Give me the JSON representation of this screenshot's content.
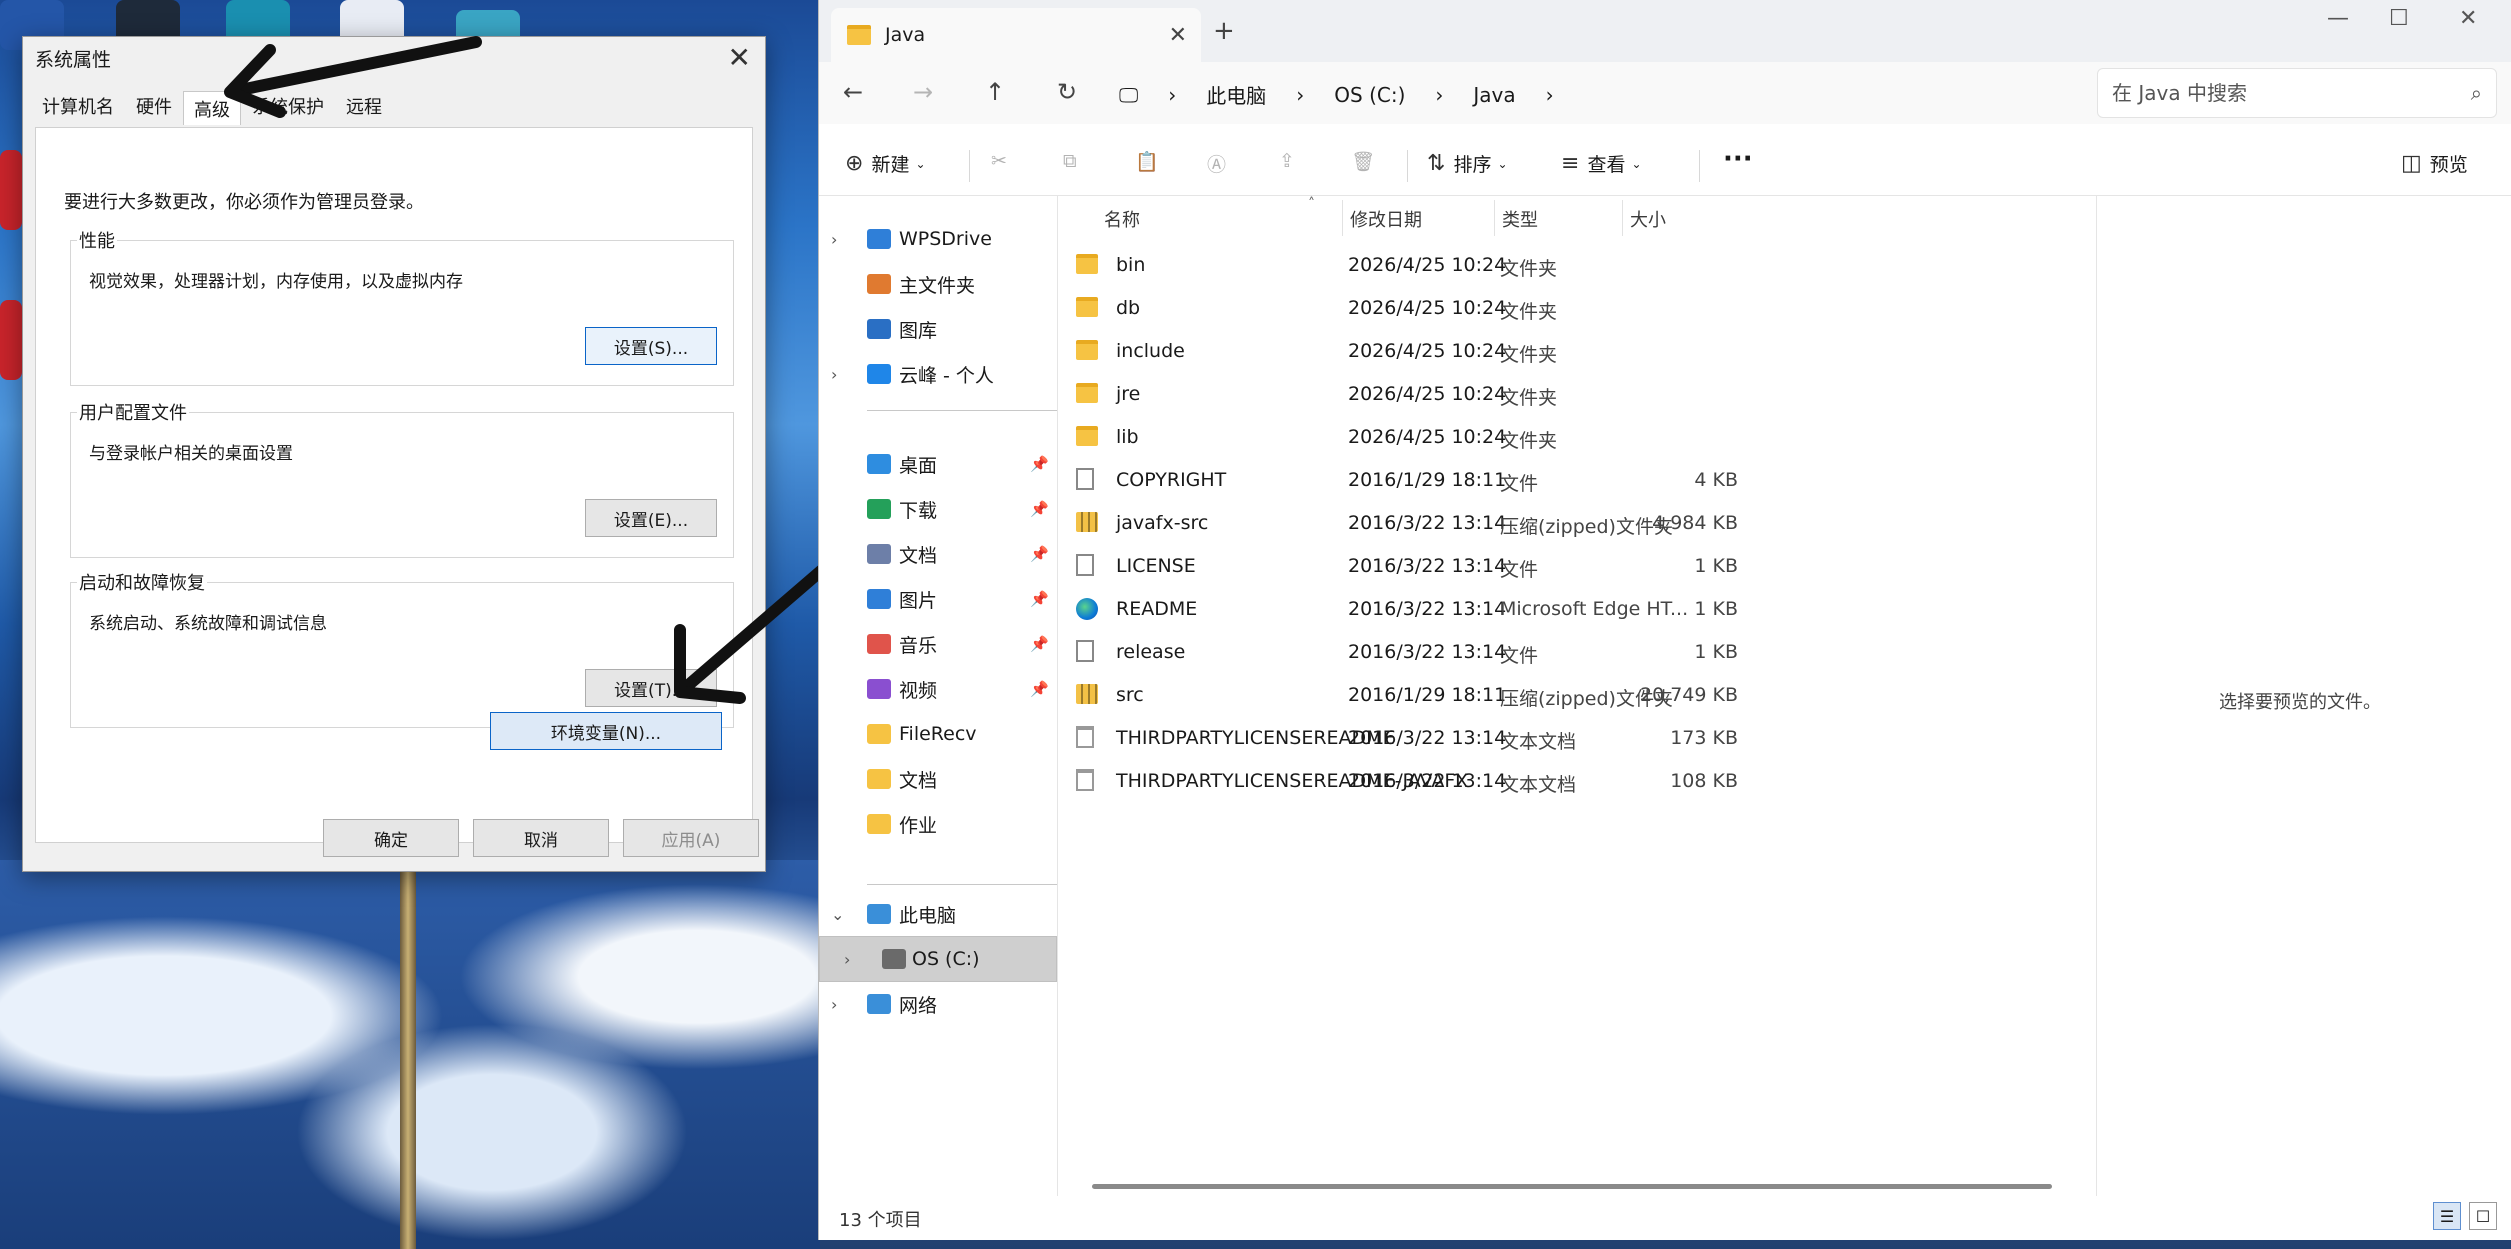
{
  "sysprops": {
    "title": "系统属性",
    "tabs": [
      "计算机名",
      "硬件",
      "高级",
      "系统保护",
      "远程"
    ],
    "admin_note": "要进行大多数更改，你必须作为管理员登录。",
    "performance": {
      "legend": "性能",
      "desc": "视觉效果，处理器计划，内存使用，以及虚拟内存",
      "button": "设置(S)..."
    },
    "profiles": {
      "legend": "用户配置文件",
      "desc": "与登录帐户相关的桌面设置",
      "button": "设置(E)..."
    },
    "startup": {
      "legend": "启动和故障恢复",
      "desc": "系统启动、系统故障和调试信息",
      "button": "设置(T)..."
    },
    "env_button": "环境变量(N)...",
    "ok": "确定",
    "cancel": "取消",
    "apply": "应用(A)"
  },
  "explorer": {
    "tab_title": "Java",
    "breadcrumb": [
      "此电脑",
      "OS (C:)",
      "Java"
    ],
    "search_placeholder": "在 Java 中搜索",
    "cmd": {
      "new": "新建",
      "sort": "排序",
      "view": "查看",
      "more": "···",
      "preview": "预览"
    },
    "sidebar": [
      {
        "label": "WPSDrive",
        "icon": "cloud-icon",
        "expandable": true
      },
      {
        "label": "主文件夹",
        "icon": "home-icon"
      },
      {
        "label": "图库",
        "icon": "gallery-icon"
      },
      {
        "label": "云峰 - 个人",
        "icon": "onedrive-icon",
        "expandable": true
      },
      {
        "label": "桌面",
        "icon": "desktop-icon",
        "pinned": true
      },
      {
        "label": "下载",
        "icon": "download-icon",
        "pinned": true
      },
      {
        "label": "文档",
        "icon": "documents-icon",
        "pinned": true
      },
      {
        "label": "图片",
        "icon": "pictures-icon",
        "pinned": true
      },
      {
        "label": "音乐",
        "icon": "music-icon",
        "pinned": true
      },
      {
        "label": "视频",
        "icon": "video-icon",
        "pinned": true
      },
      {
        "label": "FileRecv",
        "icon": "folder-icon"
      },
      {
        "label": "文档",
        "icon": "folder-icon"
      },
      {
        "label": "作业",
        "icon": "folder-icon"
      },
      {
        "label": "此电脑",
        "icon": "pc-icon",
        "expanded": true
      },
      {
        "label": "OS (C:)",
        "icon": "drive-icon",
        "expandable": true,
        "selected": true
      },
      {
        "label": "网络",
        "icon": "network-icon",
        "expandable": true
      }
    ],
    "columns": [
      "名称",
      "修改日期",
      "类型",
      "大小"
    ],
    "files": [
      {
        "name": "bin",
        "date": "2026/4/25 10:24",
        "type": "文件夹",
        "size": "",
        "kind": "folder"
      },
      {
        "name": "db",
        "date": "2026/4/25 10:24",
        "type": "文件夹",
        "size": "",
        "kind": "folder"
      },
      {
        "name": "include",
        "date": "2026/4/25 10:24",
        "type": "文件夹",
        "size": "",
        "kind": "folder"
      },
      {
        "name": "jre",
        "date": "2026/4/25 10:24",
        "type": "文件夹",
        "size": "",
        "kind": "folder"
      },
      {
        "name": "lib",
        "date": "2026/4/25 10:24",
        "type": "文件夹",
        "size": "",
        "kind": "folder"
      },
      {
        "name": "COPYRIGHT",
        "date": "2016/1/29 18:11",
        "type": "文件",
        "size": "4 KB",
        "kind": "file"
      },
      {
        "name": "javafx-src",
        "date": "2016/3/22 13:14",
        "type": "压缩(zipped)文件夹",
        "size": "4,984 KB",
        "kind": "zip"
      },
      {
        "name": "LICENSE",
        "date": "2016/3/22 13:14",
        "type": "文件",
        "size": "1 KB",
        "kind": "file"
      },
      {
        "name": "README",
        "date": "2016/3/22 13:14",
        "type": "Microsoft Edge HT...",
        "size": "1 KB",
        "kind": "edge"
      },
      {
        "name": "release",
        "date": "2016/3/22 13:14",
        "type": "文件",
        "size": "1 KB",
        "kind": "file"
      },
      {
        "name": "src",
        "date": "2016/1/29 18:11",
        "type": "压缩(zipped)文件夹",
        "size": "20,749 KB",
        "kind": "zip"
      },
      {
        "name": "THIRDPARTYLICENSEREADME",
        "date": "2016/3/22 13:14",
        "type": "文本文档",
        "size": "173 KB",
        "kind": "txt"
      },
      {
        "name": "THIRDPARTYLICENSEREADME-JAVAFX",
        "date": "2016/3/22 13:14",
        "type": "文本文档",
        "size": "108 KB",
        "kind": "txt"
      }
    ],
    "preview_text": "选择要预览的文件。",
    "status": "13 个项目"
  }
}
